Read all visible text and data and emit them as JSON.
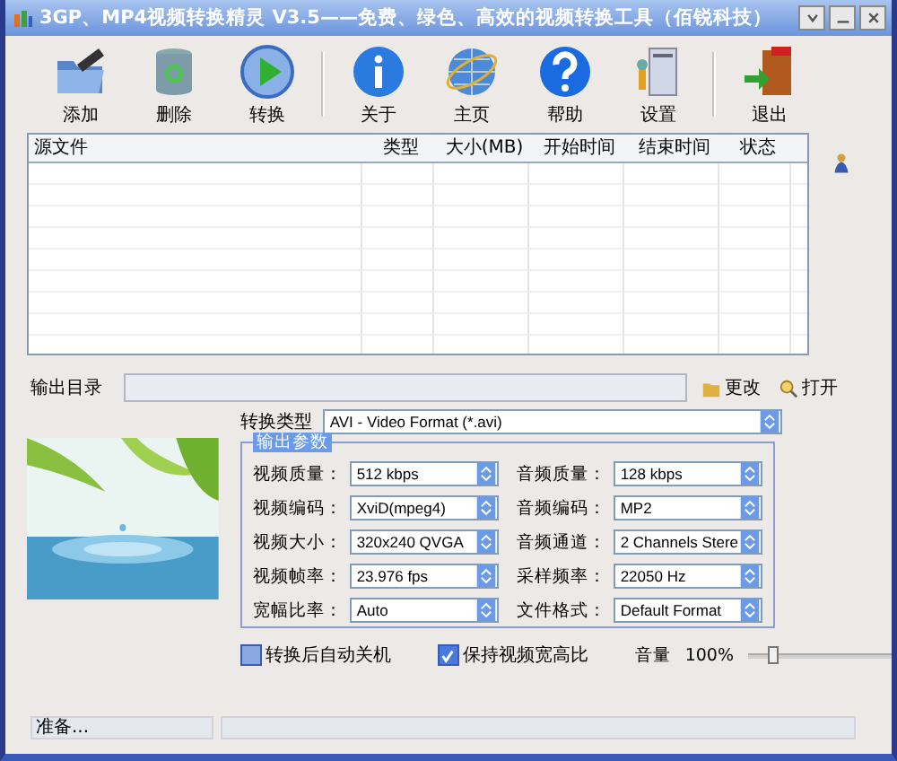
{
  "window": {
    "title": "3GP、MP4视频转换精灵 V3.5——免费、绿色、高效的视频转换工具（佰锐科技）"
  },
  "toolbar": {
    "groups": [
      [
        {
          "label": "添加",
          "kind": "add"
        },
        {
          "label": "删除",
          "kind": "delete"
        },
        {
          "label": "转换",
          "kind": "convert"
        }
      ],
      [
        {
          "label": "关于",
          "kind": "about"
        },
        {
          "label": "主页",
          "kind": "home"
        },
        {
          "label": "帮助",
          "kind": "help"
        },
        {
          "label": "设置",
          "kind": "settings"
        }
      ],
      [
        {
          "label": "退出",
          "kind": "exit"
        }
      ]
    ]
  },
  "table": {
    "columns": [
      "源文件",
      "类型",
      "大小(MB)",
      "开始时间",
      "结束时间",
      "状态"
    ]
  },
  "output": {
    "label": "输出目录",
    "buttons": [
      {
        "label": "更改",
        "kind": "change"
      },
      {
        "label": "打开",
        "kind": "open"
      }
    ]
  },
  "convert_type": {
    "label": "转换类型",
    "value": "AVI - Video Format (*.avi)"
  },
  "params": {
    "title": "输出参数",
    "fields": [
      {
        "label": "视频质量：",
        "value": "512 kbps"
      },
      {
        "label": "音频质量：",
        "value": "128 kbps"
      },
      {
        "label": "视频编码：",
        "value": "XviD(mpeg4)"
      },
      {
        "label": "音频编码：",
        "value": "MP2"
      },
      {
        "label": "视频大小：",
        "value": "320x240 QVGA"
      },
      {
        "label": "音频通道：",
        "value": "2 Channels Stere"
      },
      {
        "label": "视频帧率：",
        "value": "23.976 fps"
      },
      {
        "label": "采样频率：",
        "value": "22050 Hz"
      },
      {
        "label": "宽幅比率：",
        "value": "Auto"
      },
      {
        "label": "文件格式：",
        "value": "Default Format"
      }
    ]
  },
  "options": [
    {
      "label": "转换后自动关机",
      "checked": false
    },
    {
      "label": "保持视频宽高比",
      "checked": true
    }
  ],
  "volume": {
    "label": "音量",
    "reading": "100%",
    "level": 0.18
  },
  "status_bar": {
    "text": "准备..."
  }
}
